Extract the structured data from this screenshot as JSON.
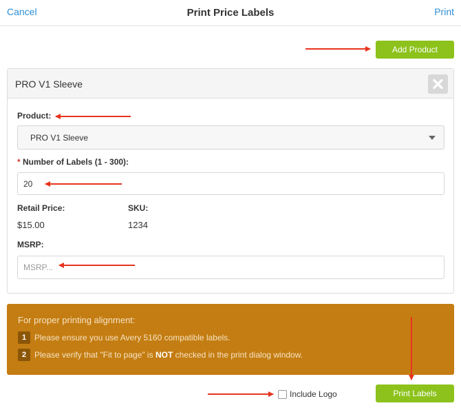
{
  "header": {
    "cancel_label": "Cancel",
    "title": "Print Price Labels",
    "print_label": "Print"
  },
  "toolbar": {
    "add_product_label": "Add Product"
  },
  "product_card": {
    "title": "PRO V1 Sleeve",
    "product_label": "Product:",
    "product_value": "PRO V1 Sleeve",
    "required_mark": "*",
    "labels_count_label": "Number of Labels (1 - 300):",
    "labels_count_value": "20",
    "retail_price_label": "Retail Price:",
    "retail_price_value": "$15.00",
    "sku_label": "SKU:",
    "sku_value": "1234",
    "msrp_label": "MSRP:",
    "msrp_placeholder": "MSRP..."
  },
  "notice": {
    "heading": "For proper printing alignment:",
    "steps": [
      {
        "num": "1",
        "text": "Please ensure you use Avery 5160 compatible labels."
      },
      {
        "num": "2",
        "pre": "Please verify that \"Fit to page\" is ",
        "bold": "NOT",
        "post": " checked in the print dialog window."
      }
    ]
  },
  "footer": {
    "include_logo_label": "Include Logo",
    "include_logo_checked": false,
    "print_labels_label": "Print Labels"
  },
  "colors": {
    "accent_blue": "#2d8fd5",
    "button_green": "#8cc21b",
    "notice_orange": "#c47d12",
    "annotation_red": "#e8331e"
  },
  "icons": {
    "remove": "close-icon",
    "dropdown": "chevron-down-icon"
  }
}
